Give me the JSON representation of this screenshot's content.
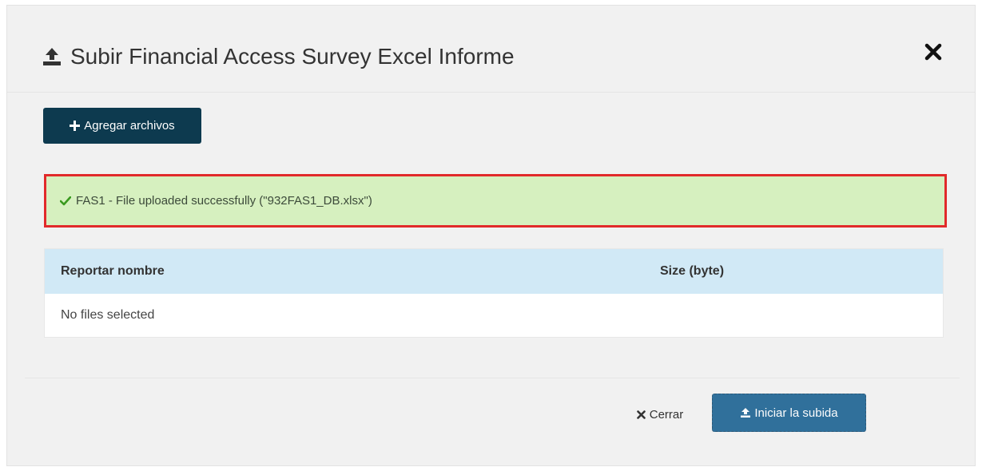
{
  "modal": {
    "title": "Subir Financial Access Survey Excel Informe",
    "title_icon": "upload-icon",
    "close_icon": "close-icon"
  },
  "toolbar": {
    "add_files_label": "Agregar archivos",
    "add_files_icon": "plus-icon"
  },
  "alert": {
    "message": "FAS1 - File uploaded successfully (\"932FAS1_DB.xlsx\")",
    "icon": "check-icon",
    "background": "#d6f0bf",
    "highlight_border": "#e12a2a"
  },
  "files_table": {
    "columns": [
      "Reportar nombre",
      "Size (byte)"
    ],
    "empty_text": "No files selected",
    "header_background": "#d1e9f6"
  },
  "footer": {
    "close_label": "Cerrar",
    "close_icon": "close-icon",
    "start_label": "Iniciar la subida",
    "start_icon": "upload-icon",
    "start_background": "#0f5a8d"
  },
  "colors": {
    "primary_dark": "#0d3a4f",
    "modal_background": "#f1f1f1"
  }
}
